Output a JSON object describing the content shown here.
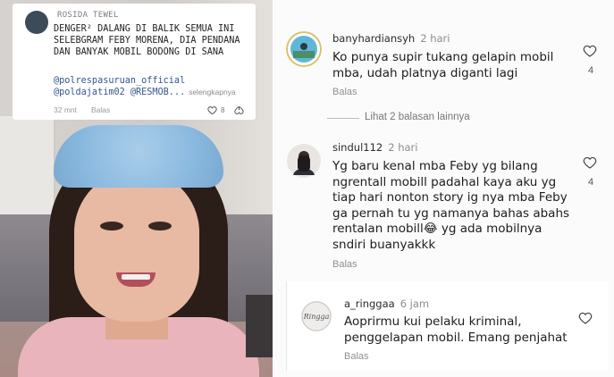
{
  "overlay": {
    "username": "ROSIDA TEWEL",
    "body": "DENGER² DALANG DI BALIK SEMUA INI SELEBGRAM FEBY MORENA, DIA PENDANA DAN BANYAK MOBIL BODONG DI SANA",
    "tags": "@polrespasuruan_official @poldajatim02 @RESMOB...",
    "more": "selengkapnya",
    "time": "32 mnt",
    "reply": "Balas",
    "likes": "8"
  },
  "comments": [
    {
      "username": "banyhardiansyh",
      "time": "2 hari",
      "text": "Ko punya supir tukang gelapin mobil mba, udah platnya diganti lagi",
      "reply": "Balas",
      "likes": "4"
    },
    {
      "username": "sindul112",
      "time": "2 hari",
      "text": "Yg baru kenal mba Feby yg bilang ngrentall mobill padahal kaya aku yg tiap hari nonton story ig nya mba Feby ga pernah tu yg namanya bahas abahs rentalan mobill😂 yg ada mobilnya sndiri buanyakkk",
      "reply": "Balas",
      "likes": "4"
    }
  ],
  "view_replies": "Lihat 2 balasan lainnya",
  "nested_reply": {
    "username": "a_ringgaa",
    "time": "6 jam",
    "text": "Aoprirmu kui pelaku kriminal, penggelapan mobil. Emang penjahat",
    "reply": "Balas",
    "avatar_text": "Ringga"
  },
  "colors": {
    "tag_link": "#34558c",
    "muted": "#8f8f8f"
  }
}
